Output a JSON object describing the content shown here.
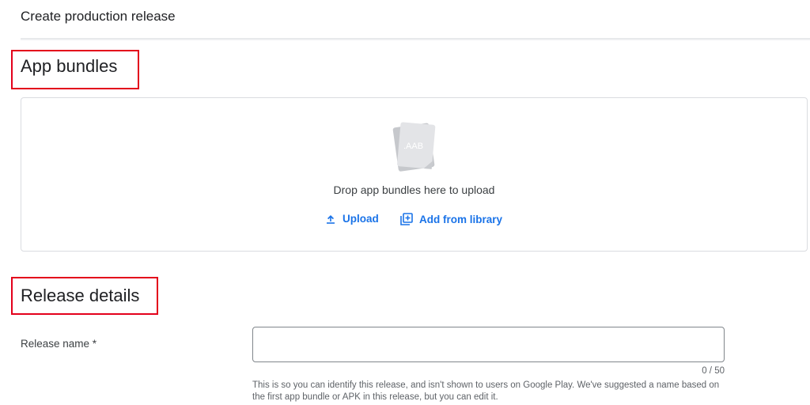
{
  "page": {
    "title": "Create production release"
  },
  "app_bundles": {
    "heading": "App bundles",
    "icon_label": ".AAB",
    "drop_text": "Drop app bundles here to upload",
    "upload_label": "Upload",
    "add_from_library_label": "Add from library"
  },
  "release_details": {
    "heading": "Release details",
    "release_name": {
      "label": "Release name  *",
      "value": "",
      "counter": "0 / 50",
      "helper": "This is so you can identify this release, and isn't shown to users on Google Play. We've suggested a name based on the first app bundle or APK in this release, but you can edit it."
    }
  },
  "colors": {
    "accent": "#1a73e8",
    "highlight": "#e3001b",
    "border": "#dadce0"
  },
  "icons": {
    "upload": "upload-icon",
    "library": "add-to-library-icon",
    "bundle": "aab-file-icon"
  }
}
